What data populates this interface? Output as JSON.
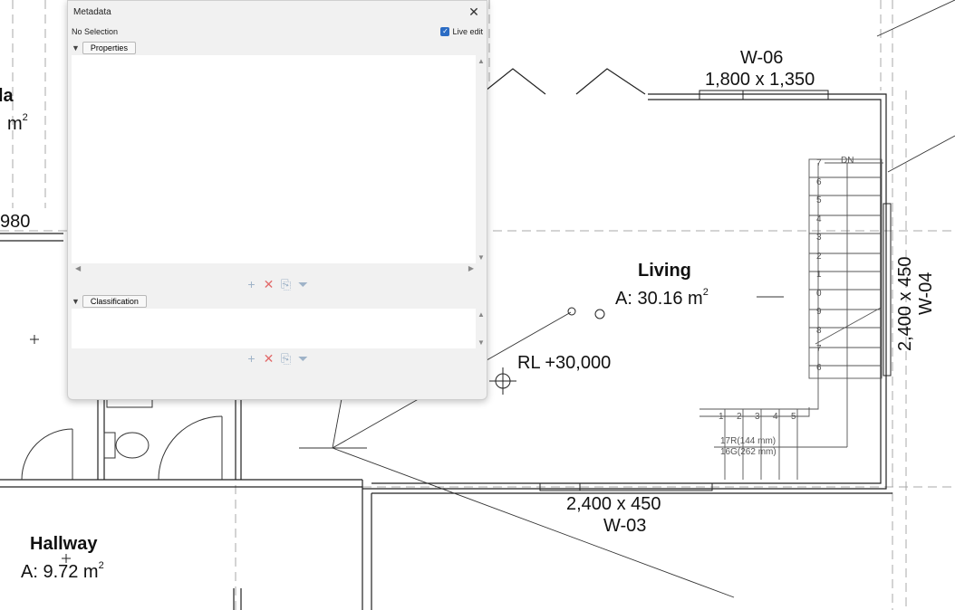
{
  "panel": {
    "title": "Metadata",
    "close_glyph": "✕",
    "selection_status": "No Selection",
    "live_edit_label": "Live edit",
    "live_edit_checked": true,
    "properties_label": "Properties",
    "classification_label": "Classification",
    "tool_icons": [
      "plus-icon",
      "delete-icon",
      "copy-icon",
      "filter-icon"
    ],
    "tool_glyphs": {
      "add": "+",
      "delete": "✕",
      "copy": "⎘",
      "filter": "⏷"
    }
  },
  "plan": {
    "rooms": [
      {
        "name": "Living",
        "area": "A: 30.16 m",
        "unit_sup": "2"
      },
      {
        "name": "Hallway",
        "area": "A: 9.72 m",
        "unit_sup": "2"
      }
    ],
    "partial_room": {
      "name_fragment": "la",
      "area_fragment": "m",
      "unit_sup": "2"
    },
    "windows": [
      {
        "tag": "W-06",
        "size": "1,800 x 1,350"
      },
      {
        "tag": "W-04",
        "size": "2,400 x 450"
      },
      {
        "tag": "W-03",
        "size": "2,400 x 450"
      }
    ],
    "dimension_fragment": "980",
    "level_marker": "RL +30,000",
    "stair": {
      "direction": "DN",
      "riser_note": "17R(144 mm)",
      "going_note": "16G(262 mm)",
      "upper_numbers": [
        "7",
        "6",
        "5",
        "4",
        "3",
        "2",
        "1",
        "0",
        "9",
        "8",
        "7",
        "6"
      ],
      "lower_numbers": [
        "1",
        "2",
        "3",
        "4",
        "5"
      ]
    },
    "colors": {
      "line": "#222222",
      "dashed": "#9a9a9a",
      "panel_bg": "#f1f1f1",
      "accent": "#2b6cc4"
    }
  }
}
